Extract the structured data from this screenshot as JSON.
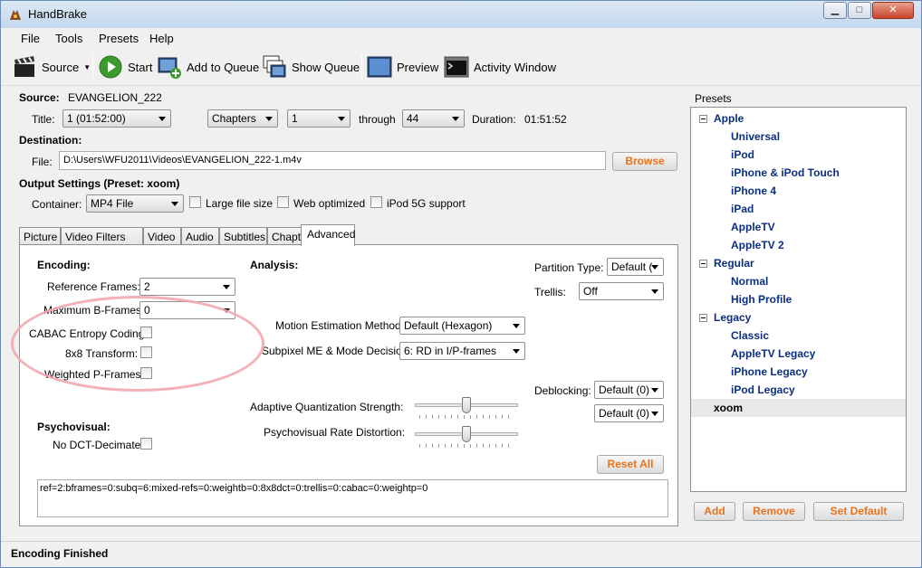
{
  "window": {
    "title": "HandBrake",
    "minimize": "▁",
    "maximize": "□",
    "close": "✕"
  },
  "menu": {
    "file": "File",
    "tools": "Tools",
    "presets": "Presets",
    "help": "Help"
  },
  "toolbar": {
    "source": "Source",
    "start": "Start",
    "add_to_queue": "Add to Queue",
    "show_queue": "Show Queue",
    "preview": "Preview",
    "activity_window": "Activity Window"
  },
  "source": {
    "label": "Source:",
    "value": "EVANGELION_222",
    "title_label": "Title:",
    "title_value": "1 (01:52:00)",
    "range_type": "Chapters",
    "range_start": "1",
    "through_label": "through",
    "range_end": "44",
    "duration_label": "Duration:",
    "duration_value": "01:51:52"
  },
  "destination": {
    "label": "Destination:",
    "file_label": "File:",
    "file_value": "D:\\Users\\WFU2011\\Videos\\EVANGELION_222-1.m4v",
    "browse": "Browse"
  },
  "output": {
    "label": "Output Settings (Preset: xoom)",
    "container_label": "Container:",
    "container_value": "MP4 File",
    "large_file": "Large file size",
    "web_optimized": "Web optimized",
    "ipod_5g": "iPod 5G support"
  },
  "tabs": [
    "Picture",
    "Video Filters",
    "Video",
    "Audio",
    "Subtitles",
    "Chapters",
    "Advanced"
  ],
  "advanced": {
    "encoding_header": "Encoding:",
    "ref_frames_label": "Reference Frames:",
    "ref_frames_value": "2",
    "max_bframes_label": "Maximum B-Frames:",
    "max_bframes_value": "0",
    "cabac_label": "CABAC Entropy Coding:",
    "transform_label": "8x8 Transform:",
    "weighted_label": "Weighted P-Frames:",
    "psychovisual_header": "Psychovisual:",
    "dct_label": "No DCT-Decimate:",
    "analysis_header": "Analysis:",
    "motion_label": "Motion Estimation Method:",
    "motion_value": "Default (Hexagon)",
    "subpixel_label": "Subpixel ME & Mode Decision:",
    "subpixel_value": "6: RD in I/P-frames",
    "partition_label": "Partition Type:",
    "partition_value": "Default (",
    "trellis_label": "Trellis:",
    "trellis_value": "Off",
    "deblocking_label": "Deblocking:",
    "deblocking_value1": "Default (0)",
    "deblocking_value2": "Default (0)",
    "aq_label": "Adaptive Quantization Strength:",
    "aq_level": 0.5,
    "psy_rd_label": "Psychovisual Rate Distortion:",
    "psy_rd_level": 0.5,
    "reset_all": "Reset All",
    "x264_string": "ref=2:bframes=0:subq=6:mixed-refs=0:weightb=0:8x8dct=0:trellis=0:cabac=0:weightp=0"
  },
  "presets": {
    "header": "Presets",
    "groups": [
      {
        "name": "Apple",
        "items": [
          "Universal",
          "iPod",
          "iPhone & iPod Touch",
          "iPhone 4",
          "iPad",
          "AppleTV",
          "AppleTV 2"
        ]
      },
      {
        "name": "Regular",
        "items": [
          "Normal",
          "High Profile"
        ]
      },
      {
        "name": "Legacy",
        "items": [
          "Classic",
          "AppleTV Legacy",
          "iPhone Legacy",
          "iPod Legacy"
        ]
      }
    ],
    "custom": "xoom",
    "add": "Add",
    "remove": "Remove",
    "set_default": "Set Default"
  },
  "status": {
    "text": "Encoding Finished"
  },
  "colors": {
    "accent": "#e8731c",
    "preset_text": "#0b2f80",
    "highlight_circle": "#f2a7ae"
  }
}
